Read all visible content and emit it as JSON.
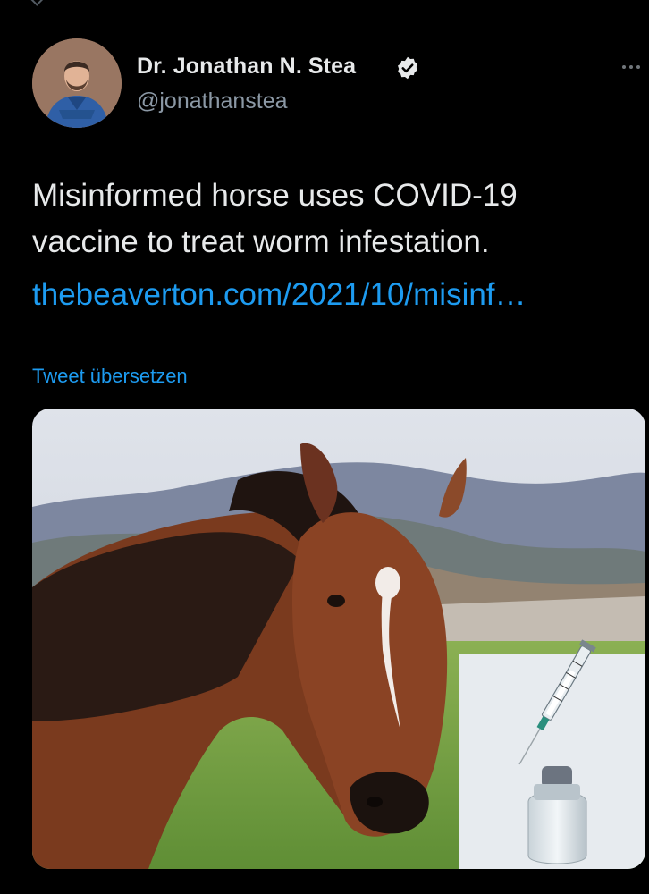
{
  "tweet": {
    "author": {
      "display_name": "Dr. Jonathan N. Stea",
      "handle": "@jonathanstea",
      "verified": true,
      "avatar": "profile-photo-man-with-beard-blue-shirt"
    },
    "text_lines": [
      "Misinformed horse uses COVID-19",
      "vaccine to treat worm infestation."
    ],
    "link_text": "thebeaverton.com/2021/10/misinf…",
    "translate_label": "Tweet übersetzen",
    "media": {
      "description": "brown-horse-with-white-blaze-and-vaccine-syringe-inset"
    },
    "more_icon": "ellipsis-icon"
  },
  "colors": {
    "background": "#000000",
    "text_primary": "#e7e9ea",
    "text_secondary": "#8b98a5",
    "link": "#1d9bf0"
  }
}
